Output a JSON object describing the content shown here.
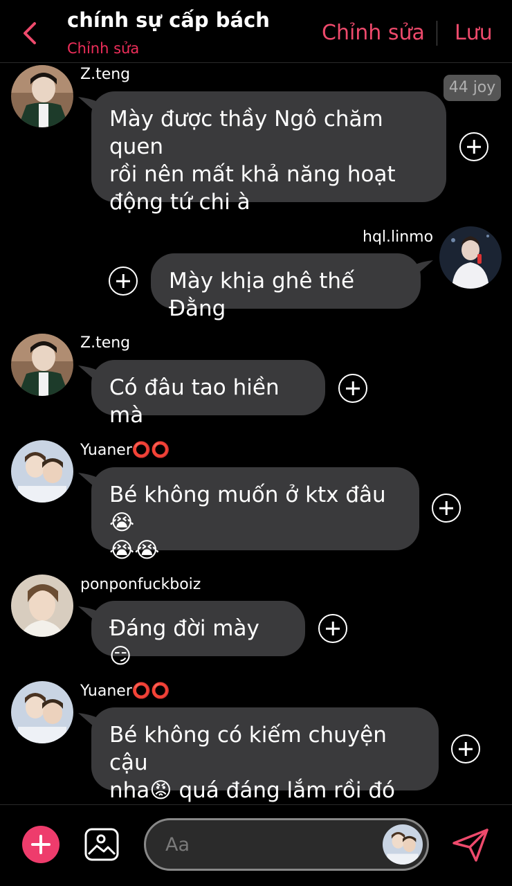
{
  "header": {
    "title": "chính sự cấp bách",
    "subtitle": "Chỉnh sửa",
    "edit_label": "Chỉnh sửa",
    "save_label": "Lưu",
    "accent_color": "#ee4a6c"
  },
  "badge": {
    "text": "44 joy"
  },
  "messages": [
    {
      "sender": "Z.teng",
      "text_lines": [
        "Mày được thầy Ngô chăm quen",
        "rồi nên mất khả năng hoạt",
        "động tứ chi à"
      ],
      "side": "left"
    },
    {
      "sender": "hql.linmo",
      "text_lines": [
        "Mày khịa ghê thế Đằng"
      ],
      "side": "right"
    },
    {
      "sender": "Z.teng",
      "text_lines": [
        "Có đâu tao hiền mà"
      ],
      "side": "left"
    },
    {
      "sender": "Yuaner⭕⭕",
      "text_lines": [
        "Bé không muốn ở ktx đâu😭",
        "😭😭"
      ],
      "side": "left"
    },
    {
      "sender": "ponponfuckboiz",
      "text_lines": [
        "Đáng đời mày 😏"
      ],
      "side": "left"
    },
    {
      "sender": "Yuaner⭕⭕",
      "text_lines": [
        "Bé không có kiếm chuyện cậu",
        "nha😡 quá đáng lắm rồi đó"
      ],
      "side": "left"
    }
  ],
  "composer": {
    "placeholder": "Aa",
    "icons": [
      "plus-circle-icon",
      "image-icon",
      "send-icon"
    ]
  }
}
